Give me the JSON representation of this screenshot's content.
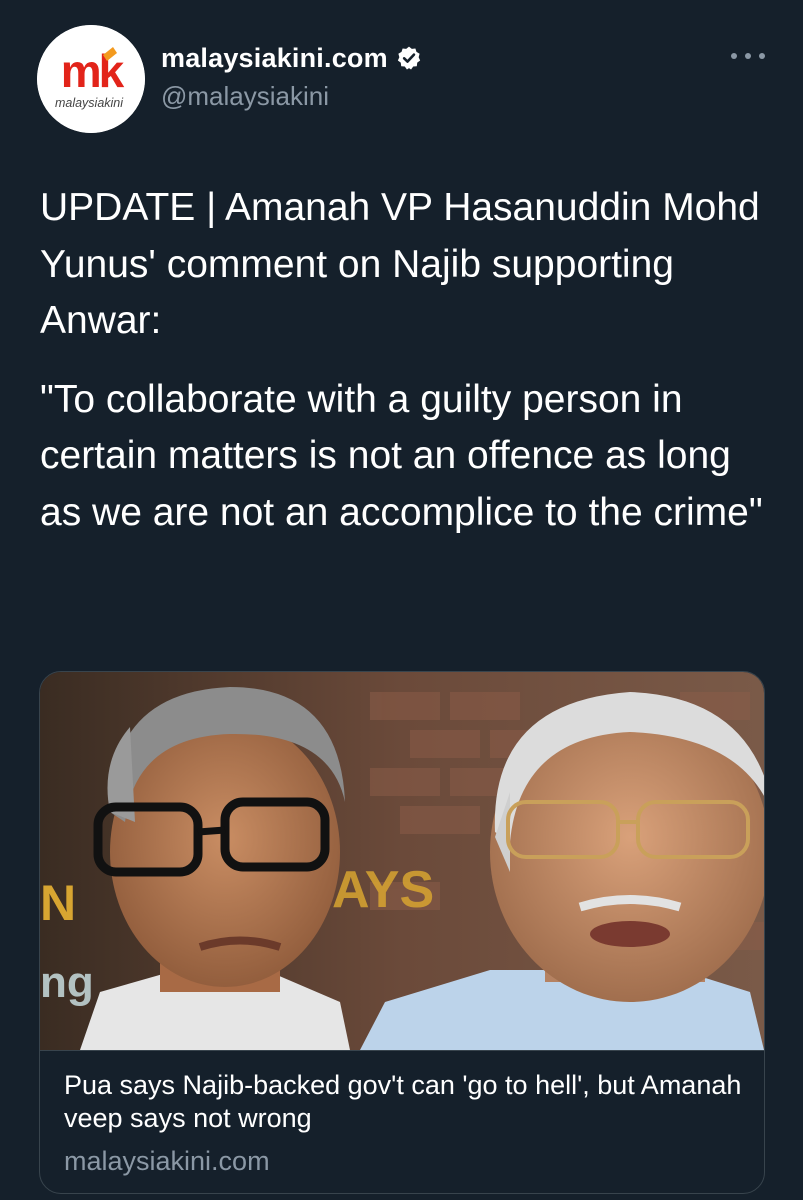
{
  "author": {
    "display_name": "malaysiakini.com",
    "handle": "@malaysiakini",
    "verified": true,
    "avatar_logo_text": "mk",
    "avatar_wordmark": "malaysiakini"
  },
  "tweet": {
    "text_paragraphs": [
      "UPDATE | Amanah VP Hasanuddin Mohd Yunus' comment on Najib supporting Anwar:",
      "\"To collaborate with a guilty person in certain matters is not an offence as long as we are not an accomplice to the crime\""
    ]
  },
  "link_card": {
    "title": "Pua says Najib-backed gov't can 'go to hell', but Amanah veep says not wrong",
    "domain": "malaysiakini.com",
    "image_background_text": [
      "N",
      "AYS",
      "ng"
    ]
  },
  "icons": {
    "more": "more-horizontal-icon",
    "verified": "verified-badge-icon"
  },
  "colors": {
    "background": "#15202b",
    "secondary_text": "#8b98a5",
    "border": "#38444d",
    "brand_red": "#e2241a",
    "brand_orange": "#f39a1e"
  }
}
